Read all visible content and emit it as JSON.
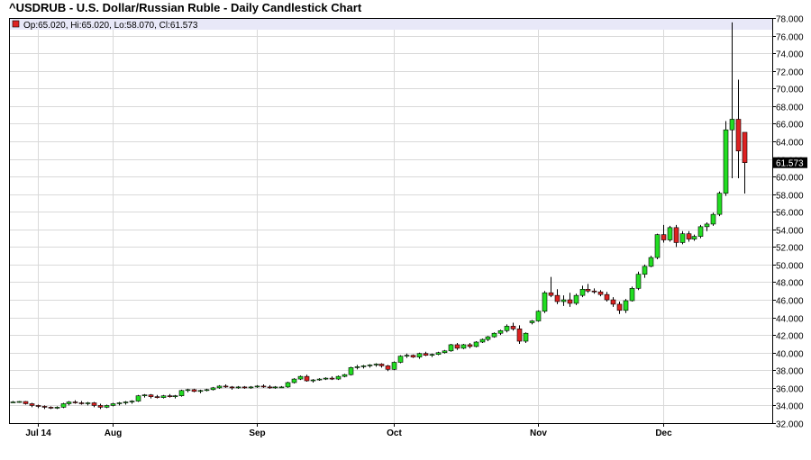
{
  "chart_data": {
    "type": "candlestick",
    "title": "^USDRUB - U.S. Dollar/Russian Ruble - Daily Candlestick Chart",
    "info": {
      "text": "Op:65.020, Hi:65.020, Lo:58.070, Cl:61.573"
    },
    "last_value_label": "61.573",
    "last_value": 61.573,
    "ylim": [
      32,
      78
    ],
    "y_ticks": [
      "32.000",
      "34.000",
      "36.000",
      "38.000",
      "40.000",
      "42.000",
      "44.000",
      "46.000",
      "48.000",
      "50.000",
      "52.000",
      "54.000",
      "56.000",
      "58.000",
      "60.000",
      "62.000",
      "64.000",
      "66.000",
      "68.000",
      "70.000",
      "72.000",
      "74.000",
      "76.000",
      "78.000"
    ],
    "x_ticks": [
      {
        "index": 4,
        "label": "Jul 14"
      },
      {
        "index": 16,
        "label": "Aug"
      },
      {
        "index": 39,
        "label": "Sep"
      },
      {
        "index": 61,
        "label": "Oct"
      },
      {
        "index": 84,
        "label": "Nov"
      },
      {
        "index": 104,
        "label": "Dec"
      }
    ],
    "grid": true,
    "colors": {
      "up": "#22dd22",
      "down": "#dd2222",
      "grid": "#d9d9d9",
      "info_bg": "#e8e8f8"
    },
    "candles": [
      [
        34.4,
        34.5,
        34.3,
        34.4
      ],
      [
        34.4,
        34.5,
        34.3,
        34.45
      ],
      [
        34.45,
        34.5,
        34.1,
        34.2
      ],
      [
        34.2,
        34.3,
        33.8,
        34.0
      ],
      [
        34.0,
        34.1,
        33.7,
        33.9
      ],
      [
        33.9,
        34.0,
        33.6,
        33.8
      ],
      [
        33.8,
        33.9,
        33.6,
        33.7
      ],
      [
        33.7,
        33.9,
        33.6,
        33.8
      ],
      [
        33.8,
        34.3,
        33.7,
        34.2
      ],
      [
        34.2,
        34.5,
        34.0,
        34.4
      ],
      [
        34.4,
        34.6,
        34.2,
        34.3
      ],
      [
        34.3,
        34.5,
        34.1,
        34.2
      ],
      [
        34.2,
        34.4,
        34.0,
        34.3
      ],
      [
        34.3,
        34.4,
        33.8,
        34.0
      ],
      [
        34.0,
        34.2,
        33.6,
        33.8
      ],
      [
        33.8,
        34.1,
        33.7,
        34.0
      ],
      [
        34.0,
        34.3,
        33.9,
        34.2
      ],
      [
        34.2,
        34.4,
        34.0,
        34.3
      ],
      [
        34.3,
        34.5,
        34.1,
        34.4
      ],
      [
        34.4,
        34.6,
        34.2,
        34.5
      ],
      [
        34.5,
        35.2,
        34.4,
        35.1
      ],
      [
        35.1,
        35.3,
        34.9,
        35.2
      ],
      [
        35.2,
        35.3,
        34.8,
        35.0
      ],
      [
        35.0,
        35.2,
        34.8,
        34.9
      ],
      [
        34.9,
        35.2,
        34.8,
        35.1
      ],
      [
        35.1,
        35.3,
        34.9,
        35.0
      ],
      [
        35.0,
        35.2,
        34.8,
        35.1
      ],
      [
        35.1,
        35.8,
        35.0,
        35.7
      ],
      [
        35.7,
        35.9,
        35.5,
        35.8
      ],
      [
        35.8,
        35.9,
        35.5,
        35.6
      ],
      [
        35.6,
        35.8,
        35.4,
        35.7
      ],
      [
        35.7,
        35.9,
        35.6,
        35.8
      ],
      [
        35.8,
        36.1,
        35.7,
        36.0
      ],
      [
        36.0,
        36.3,
        35.9,
        36.2
      ],
      [
        36.2,
        36.4,
        36.0,
        36.1
      ],
      [
        36.1,
        36.2,
        35.8,
        36.0
      ],
      [
        36.0,
        36.2,
        35.9,
        36.1
      ],
      [
        36.1,
        36.2,
        35.9,
        36.0
      ],
      [
        36.0,
        36.2,
        35.9,
        36.1
      ],
      [
        36.1,
        36.3,
        36.0,
        36.2
      ],
      [
        36.2,
        36.4,
        36.0,
        36.1
      ],
      [
        36.1,
        36.3,
        35.9,
        36.0
      ],
      [
        36.0,
        36.2,
        35.9,
        36.1
      ],
      [
        36.1,
        36.2,
        36.0,
        36.1
      ],
      [
        36.1,
        36.7,
        36.0,
        36.6
      ],
      [
        36.6,
        37.1,
        36.5,
        37.0
      ],
      [
        37.0,
        37.4,
        36.9,
        37.3
      ],
      [
        37.3,
        37.5,
        36.7,
        36.8
      ],
      [
        36.8,
        37.0,
        36.6,
        36.9
      ],
      [
        36.9,
        37.1,
        36.8,
        37.0
      ],
      [
        37.0,
        37.2,
        36.9,
        37.1
      ],
      [
        37.1,
        37.3,
        36.9,
        37.0
      ],
      [
        37.0,
        37.4,
        36.9,
        37.3
      ],
      [
        37.3,
        37.6,
        37.2,
        37.5
      ],
      [
        37.5,
        38.4,
        37.4,
        38.3
      ],
      [
        38.3,
        38.6,
        38.1,
        38.4
      ],
      [
        38.4,
        38.6,
        38.2,
        38.5
      ],
      [
        38.5,
        38.7,
        38.3,
        38.6
      ],
      [
        38.6,
        38.8,
        38.4,
        38.7
      ],
      [
        38.7,
        38.8,
        38.3,
        38.5
      ],
      [
        38.5,
        38.6,
        37.9,
        38.1
      ],
      [
        38.1,
        39.0,
        38.0,
        38.9
      ],
      [
        38.9,
        39.7,
        38.8,
        39.6
      ],
      [
        39.6,
        39.9,
        39.4,
        39.7
      ],
      [
        39.7,
        39.8,
        39.4,
        39.5
      ],
      [
        39.5,
        40.0,
        39.3,
        39.9
      ],
      [
        39.9,
        40.1,
        39.6,
        39.7
      ],
      [
        39.7,
        39.9,
        39.5,
        39.8
      ],
      [
        39.8,
        40.1,
        39.7,
        40.0
      ],
      [
        40.0,
        40.3,
        39.9,
        40.2
      ],
      [
        40.2,
        41.0,
        40.1,
        40.9
      ],
      [
        40.9,
        41.1,
        40.3,
        40.5
      ],
      [
        40.5,
        41.0,
        40.4,
        40.9
      ],
      [
        40.9,
        41.1,
        40.5,
        40.7
      ],
      [
        40.7,
        41.3,
        40.6,
        41.2
      ],
      [
        41.2,
        41.6,
        41.1,
        41.5
      ],
      [
        41.5,
        41.9,
        41.3,
        41.8
      ],
      [
        41.8,
        42.3,
        41.7,
        42.2
      ],
      [
        42.2,
        42.6,
        42.0,
        42.5
      ],
      [
        42.5,
        43.2,
        42.3,
        43.0
      ],
      [
        43.0,
        43.4,
        42.5,
        42.7
      ],
      [
        42.7,
        43.1,
        41.0,
        41.3
      ],
      [
        41.3,
        42.3,
        41.1,
        42.2
      ],
      [
        43.4,
        43.7,
        43.2,
        43.6
      ],
      [
        43.6,
        44.8,
        43.5,
        44.7
      ],
      [
        44.7,
        47.0,
        44.5,
        46.8
      ],
      [
        46.8,
        48.6,
        46.3,
        46.5
      ],
      [
        46.5,
        47.2,
        45.5,
        45.8
      ],
      [
        45.8,
        46.5,
        45.3,
        46.0
      ],
      [
        46.0,
        46.8,
        45.2,
        45.6
      ],
      [
        45.6,
        46.7,
        45.4,
        46.5
      ],
      [
        46.5,
        47.6,
        46.3,
        47.2
      ],
      [
        47.2,
        47.8,
        46.8,
        47.0
      ],
      [
        47.0,
        47.3,
        46.7,
        46.9
      ],
      [
        46.9,
        47.1,
        46.4,
        46.6
      ],
      [
        46.6,
        46.9,
        45.8,
        46.0
      ],
      [
        46.0,
        46.3,
        45.2,
        45.5
      ],
      [
        45.5,
        45.8,
        44.4,
        44.8
      ],
      [
        44.8,
        46.1,
        44.5,
        45.9
      ],
      [
        45.9,
        47.5,
        45.8,
        47.3
      ],
      [
        47.3,
        49.2,
        47.1,
        48.9
      ],
      [
        48.9,
        50.0,
        48.5,
        49.8
      ],
      [
        49.8,
        51.0,
        49.7,
        50.8
      ],
      [
        50.8,
        53.5,
        50.6,
        53.4
      ],
      [
        53.4,
        54.5,
        52.5,
        52.8
      ],
      [
        52.8,
        54.4,
        52.6,
        54.2
      ],
      [
        54.2,
        54.5,
        52.0,
        52.5
      ],
      [
        52.5,
        53.8,
        52.3,
        53.5
      ],
      [
        53.5,
        53.8,
        52.6,
        52.9
      ],
      [
        52.9,
        53.4,
        52.7,
        53.2
      ],
      [
        53.2,
        54.5,
        53.0,
        54.3
      ],
      [
        54.3,
        54.8,
        53.8,
        54.6
      ],
      [
        54.6,
        55.9,
        54.4,
        55.7
      ],
      [
        55.7,
        58.3,
        55.5,
        58.1
      ],
      [
        58.1,
        66.3,
        57.8,
        65.3
      ],
      [
        65.3,
        77.5,
        59.8,
        66.5
      ],
      [
        66.5,
        71.0,
        59.8,
        62.9
      ],
      [
        65.02,
        65.02,
        58.07,
        61.573
      ]
    ]
  }
}
